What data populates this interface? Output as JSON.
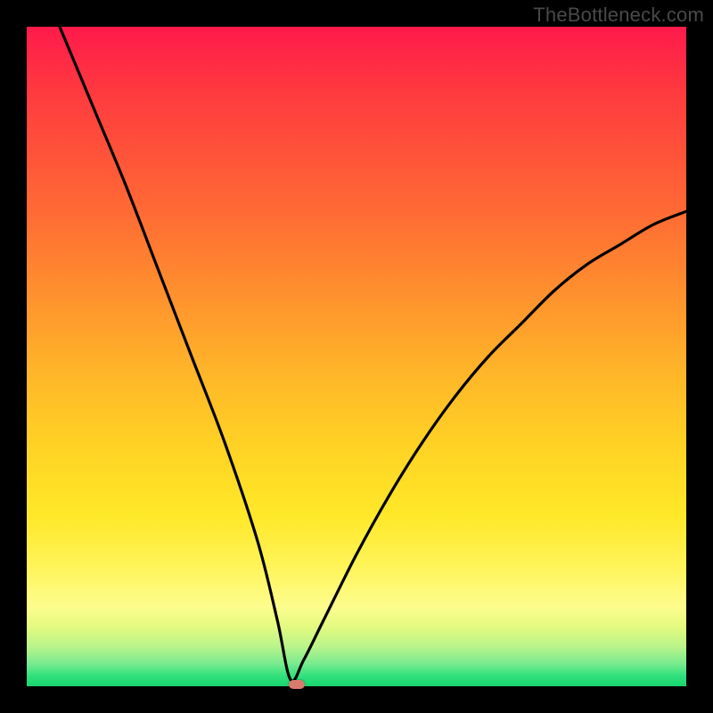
{
  "watermark": "TheBottleneck.com",
  "colors": {
    "background": "#000000",
    "curve": "#000000",
    "marker": "#d97a6e",
    "gradient_top": "#ff1a4b",
    "gradient_bottom": "#18d66e"
  },
  "chart_data": {
    "type": "line",
    "title": "",
    "xlabel": "",
    "ylabel": "",
    "xlim": [
      0,
      100
    ],
    "ylim": [
      0,
      100
    ],
    "x_at_min": 40,
    "marker": {
      "x": 41,
      "y": 0
    },
    "series": [
      {
        "name": "bottleneck-curve",
        "x": [
          5,
          10,
          15,
          20,
          25,
          30,
          35,
          38,
          40,
          42,
          45,
          50,
          55,
          60,
          65,
          70,
          75,
          80,
          85,
          90,
          95,
          100
        ],
        "values": [
          100,
          88,
          76,
          63,
          50,
          37,
          22,
          10,
          1,
          4,
          10,
          20,
          29,
          37,
          44,
          50,
          55,
          60,
          64,
          67,
          70,
          72
        ]
      }
    ],
    "annotations": []
  }
}
